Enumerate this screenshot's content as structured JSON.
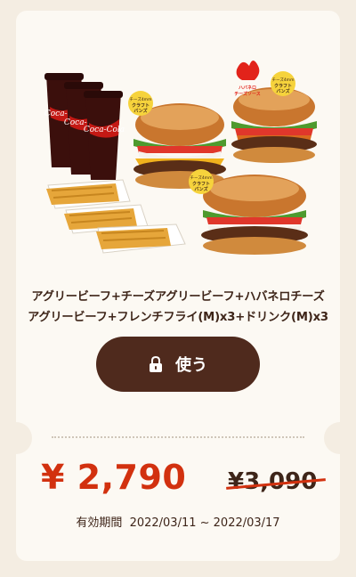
{
  "coupon": {
    "title_line1": "アグリービーフ+チーズアグリービーフ+ハバネロチーズ",
    "title_line2": "アグリービーフ+フレンチフライ(M)x3+ドリンク(M)x3",
    "use_button_label": "使う",
    "price": "¥ 2,790",
    "original_price": "¥3,090",
    "validity_label": "有効期間",
    "validity_range": "2022/03/11 ~ 2022/03/17"
  },
  "product_art": {
    "badge_text_top": "チーズ4mm",
    "badge_text_main": "クラフトバンズ",
    "habanero_badge_text": "ハバネロチーズソース",
    "drink_brand": "Coca-Cola"
  },
  "colors": {
    "price": "#d2310f",
    "button": "#4f2a1d",
    "text": "#3e2519",
    "background": "#f4ede2",
    "card": "#fcf9f3"
  }
}
